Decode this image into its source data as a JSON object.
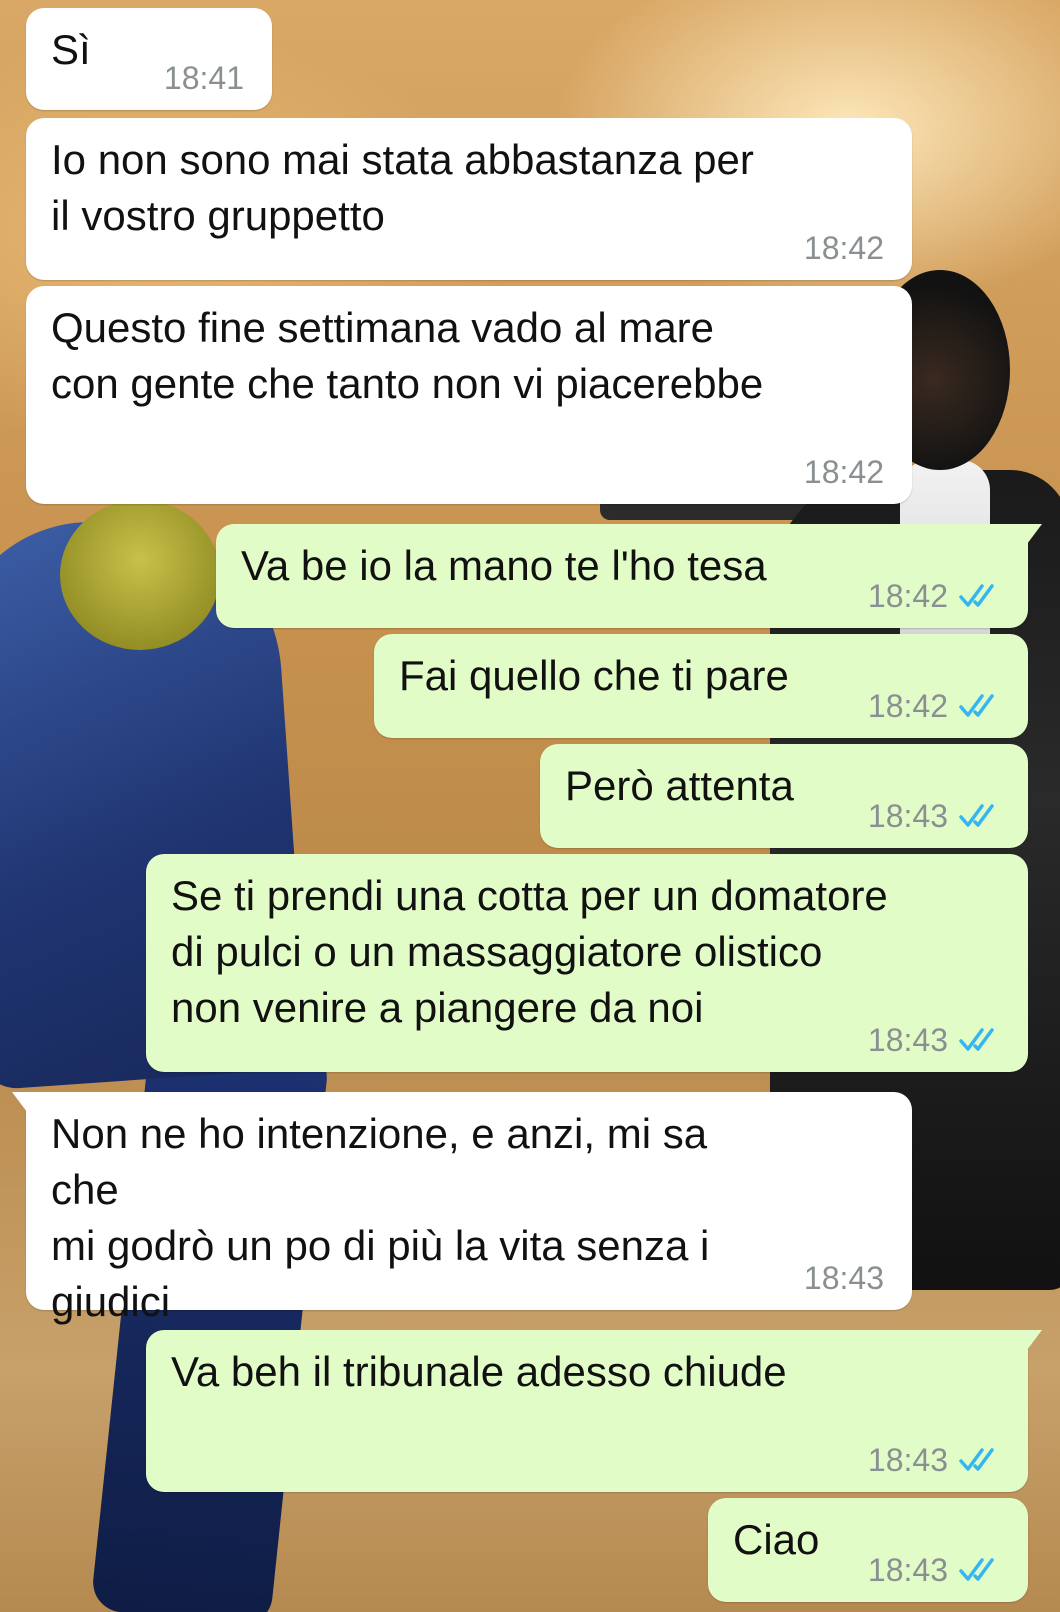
{
  "chat": {
    "messages": [
      {
        "direction": "in",
        "text": "Sì",
        "time": "18:41",
        "tail": false
      },
      {
        "direction": "in",
        "text": "Io non sono mai stata abbastanza per\nil vostro gruppetto",
        "time": "18:42",
        "tail": false
      },
      {
        "direction": "in",
        "text": "Questo fine settimana vado al mare\ncon gente che tanto non vi piacerebbe",
        "time": "18:42",
        "tail": false
      },
      {
        "direction": "out",
        "text": "Va be io la mano te l'ho tesa",
        "time": "18:42",
        "tail": true,
        "status": "read"
      },
      {
        "direction": "out",
        "text": "Fai quello che ti pare",
        "time": "18:42",
        "tail": false,
        "status": "read"
      },
      {
        "direction": "out",
        "text": "Però attenta",
        "time": "18:43",
        "tail": false,
        "status": "read"
      },
      {
        "direction": "out",
        "text": "Se ti prendi una cotta per un domatore\ndi pulci o un massaggiatore olistico\nnon venire a piangere da noi",
        "time": "18:43",
        "tail": false,
        "status": "read"
      },
      {
        "direction": "in",
        "text": "Non ne ho intenzione, e anzi, mi sa che\nmi godrò un po di più la vita senza i\ngiudici",
        "time": "18:43",
        "tail": true
      },
      {
        "direction": "out",
        "text": "Va beh il tribunale adesso chiude",
        "time": "18:43",
        "tail": true,
        "status": "read"
      },
      {
        "direction": "out",
        "text": "Ciao",
        "time": "18:43",
        "tail": false,
        "status": "read"
      }
    ]
  },
  "colors": {
    "incoming_bubble": "#ffffff",
    "outgoing_bubble": "#e2fcc8",
    "read_ticks": "#34b7f1",
    "timestamp": "#8a8f92"
  }
}
